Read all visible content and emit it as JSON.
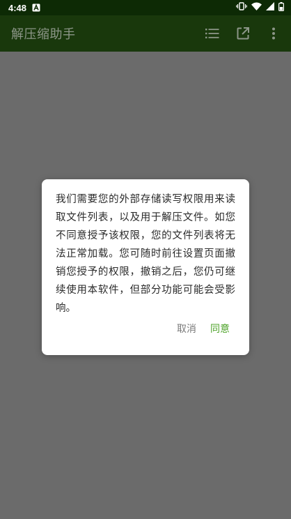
{
  "status_bar": {
    "time": "4:48",
    "notification_icon": "a-notification-icon",
    "icons": [
      "vibrate-icon",
      "wifi-icon",
      "signal-icon",
      "battery-icon"
    ]
  },
  "app_bar": {
    "title": "解压缩助手",
    "actions": [
      "list-icon",
      "open-external-icon",
      "more-vert-icon"
    ],
    "background_color": "#19380c"
  },
  "dialog": {
    "message": "我们需要您的外部存储读写权限用来读取文件列表，以及用于解压文件。如您不同意授予该权限，您的文件列表将无法正常加载。您可随时前往设置页面撤销您授予的权限，撤销之后，您仍可继续使用本软件，但部分功能可能会受影响。",
    "cancel_label": "取消",
    "agree_label": "同意",
    "agree_color": "#4ea32a"
  }
}
